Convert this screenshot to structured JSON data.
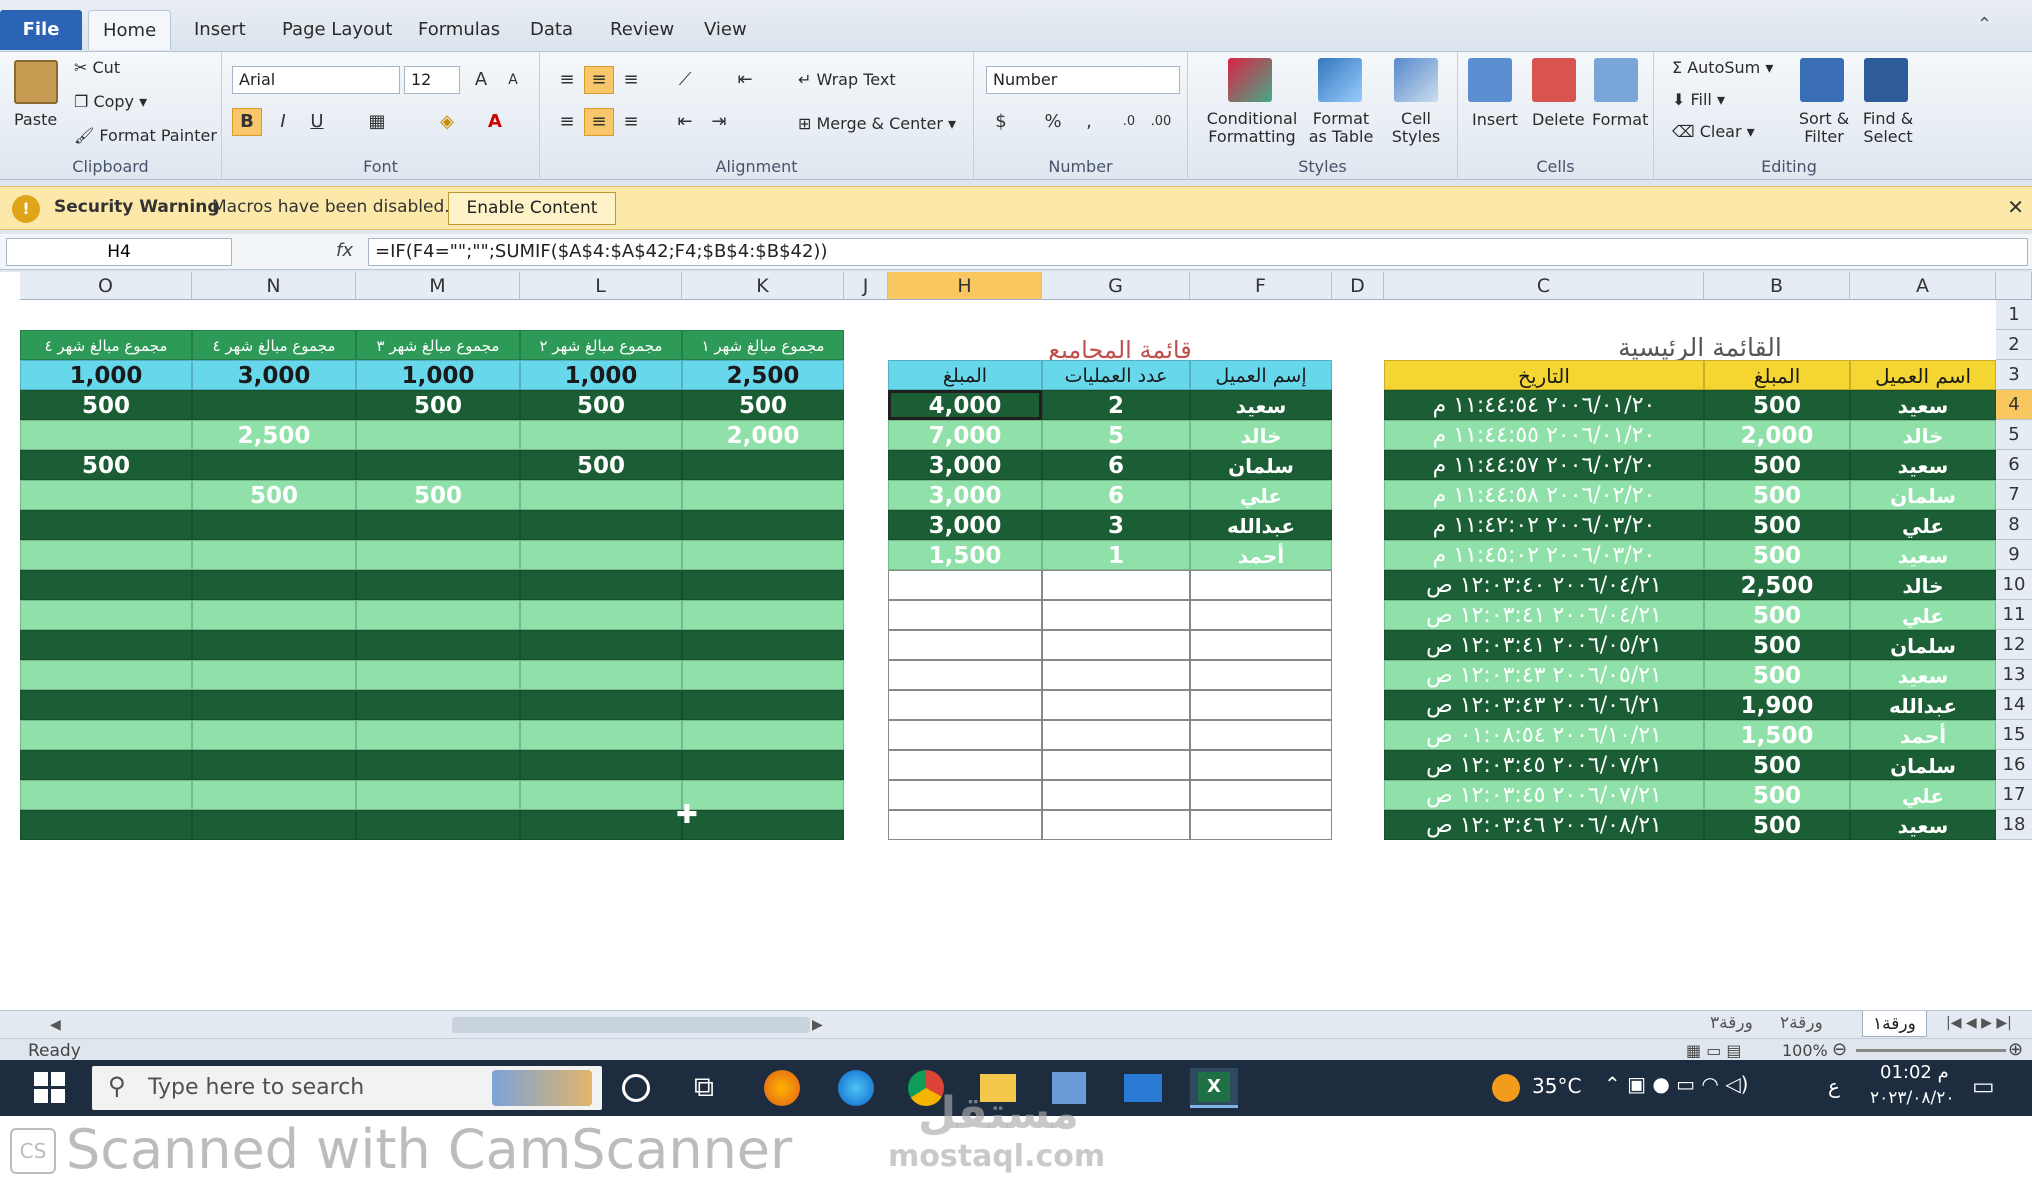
{
  "ribbon_tabs": [
    "File",
    "Home",
    "Insert",
    "Page Layout",
    "Formulas",
    "Data",
    "Review",
    "View"
  ],
  "clipboard": {
    "paste": "Paste",
    "cut": "Cut",
    "copy": "Copy",
    "format_painter": "Format Painter",
    "label": "Clipboard"
  },
  "font": {
    "name": "Arial",
    "size": "12",
    "label": "Font",
    "bold": "B",
    "italic": "I",
    "underline": "U"
  },
  "alignment": {
    "wrap": "Wrap Text",
    "merge": "Merge & Center",
    "label": "Alignment"
  },
  "number": {
    "format": "Number",
    "label": "Number",
    "percent": "%"
  },
  "styles": {
    "conditional": "Conditional Formatting",
    "format_table": "Format as Table",
    "cell_styles": "Cell Styles",
    "label": "Styles"
  },
  "cells": {
    "insert": "Insert",
    "delete": "Delete",
    "format": "Format",
    "label": "Cells"
  },
  "editing": {
    "autosum": "AutoSum",
    "fill": "Fill",
    "clear": "Clear",
    "sort": "Sort & Filter",
    "find": "Find & Select",
    "label": "Editing"
  },
  "security": {
    "title": "Security Warning",
    "message": "Macros have been disabled.",
    "button": "Enable Content"
  },
  "formula_bar": {
    "name_box": "H4",
    "fx": "fx",
    "formula": "=IF(F4=\"\";\"\";SUMIF($A$4:$A$42;F4;$B$4:$B$42))"
  },
  "columns": [
    "O",
    "N",
    "M",
    "L",
    "K",
    "J",
    "H",
    "G",
    "F",
    "D",
    "C",
    "B",
    "A"
  ],
  "rows": [
    "1",
    "2",
    "3",
    "4",
    "5",
    "6",
    "7",
    "8",
    "9",
    "10",
    "11",
    "12",
    "13",
    "14",
    "15",
    "16",
    "17",
    "18"
  ],
  "titles": {
    "main_list": "القائمة الرئيسية",
    "totals_list": "قائمة المجاميع"
  },
  "main_table": {
    "headers": {
      "client": "اسم العميل",
      "amount": "المبلغ",
      "date": "التاريخ"
    },
    "rows": [
      {
        "client": "سعيد",
        "amount": "500",
        "date": "٢٠٠٦/٠١/٢٠ ١١:٤٤:٥٤ م"
      },
      {
        "client": "خالد",
        "amount": "2,000",
        "date": "٢٠٠٦/٠١/٢٠ ١١:٤٤:٥٥ م"
      },
      {
        "client": "سعيد",
        "amount": "500",
        "date": "٢٠٠٦/٠٢/٢٠ ١١:٤٤:٥٧ م"
      },
      {
        "client": "سلمان",
        "amount": "500",
        "date": "٢٠٠٦/٠٢/٢٠ ١١:٤٤:٥٨ م"
      },
      {
        "client": "علي",
        "amount": "500",
        "date": "٢٠٠٦/٠٣/٢٠ ١١:٤٢:٠٢ م"
      },
      {
        "client": "سعيد",
        "amount": "500",
        "date": "٢٠٠٦/٠٣/٢٠ ١١:٤٥:٠٢ م"
      },
      {
        "client": "خالد",
        "amount": "2,500",
        "date": "٢٠٠٦/٠٤/٢١ ١٢:٠٣:٤٠ ص"
      },
      {
        "client": "علي",
        "amount": "500",
        "date": "٢٠٠٦/٠٤/٢١ ١٢:٠٣:٤١ ص"
      },
      {
        "client": "سلمان",
        "amount": "500",
        "date": "٢٠٠٦/٠٥/٢١ ١٢:٠٣:٤١ ص"
      },
      {
        "client": "سعيد",
        "amount": "500",
        "date": "٢٠٠٦/٠٥/٢١ ١٢:٠٣:٤٣ ص"
      },
      {
        "client": "عبدالله",
        "amount": "1,900",
        "date": "٢٠٠٦/٠٦/٢١ ١٢:٠٣:٤٣ ص"
      },
      {
        "client": "أحمد",
        "amount": "1,500",
        "date": "٢٠٠٦/١٠/٢١ ٠١:٠٨:٥٤ ص"
      },
      {
        "client": "سلمان",
        "amount": "500",
        "date": "٢٠٠٦/٠٧/٢١ ١٢:٠٣:٤٥ ص"
      },
      {
        "client": "علي",
        "amount": "500",
        "date": "٢٠٠٦/٠٧/٢١ ١٢:٠٣:٤٥ ص"
      },
      {
        "client": "سعيد",
        "amount": "500",
        "date": "٢٠٠٦/٠٨/٢١ ١٢:٠٣:٤٦ ص"
      }
    ]
  },
  "totals_table": {
    "headers": {
      "client": "إسم العميل",
      "count": "عدد العمليات",
      "amount": "المبلغ"
    },
    "rows": [
      {
        "client": "سعيد",
        "count": "2",
        "amount": "4,000"
      },
      {
        "client": "خالد",
        "count": "5",
        "amount": "7,000"
      },
      {
        "client": "سلمان",
        "count": "6",
        "amount": "3,000"
      },
      {
        "client": "علي",
        "count": "6",
        "amount": "3,000"
      },
      {
        "client": "عبدالله",
        "count": "3",
        "amount": "3,000"
      },
      {
        "client": "أحمد",
        "count": "1",
        "amount": "1,500"
      }
    ]
  },
  "monthly_table": {
    "headers": [
      "مجموع مبالغ شهر ٤",
      "مجموع مبالغ شهر ٤",
      "مجموع مبالغ شهر ٣",
      "مجموع مبالغ شهر ٢",
      "مجموع مبالغ شهر ١"
    ],
    "totals": [
      "1,000",
      "3,000",
      "1,000",
      "1,000",
      "2,500"
    ],
    "rows": [
      [
        "500",
        "",
        "500",
        "500",
        "500"
      ],
      [
        "",
        "2,500",
        "",
        "",
        "2,000"
      ],
      [
        "500",
        "",
        "",
        "500",
        ""
      ],
      [
        "",
        "500",
        "500",
        "",
        ""
      ]
    ]
  },
  "sheet_tabs": [
    "ورقة١",
    "ورقة٢",
    "ورقة٣"
  ],
  "status": {
    "ready": "Ready",
    "zoom": "100%"
  },
  "taskbar": {
    "search_placeholder": "Type here to search",
    "temperature": "35°C",
    "time": "01:02 م",
    "date": "٢٠٢٣/٠٨/٢٠",
    "lang": "ع"
  },
  "scanner": {
    "text": "Scanned with CamScanner",
    "badge": "CS"
  },
  "watermark": {
    "top": "مستقل",
    "bottom": "mostaql.com"
  },
  "colors": {
    "dark_row": "#1b5e35",
    "light_row": "#8fe1a9",
    "header_yellow": "#f4d531",
    "header_cyan": "#67d8ec",
    "security_bar": "#fce9a9"
  }
}
